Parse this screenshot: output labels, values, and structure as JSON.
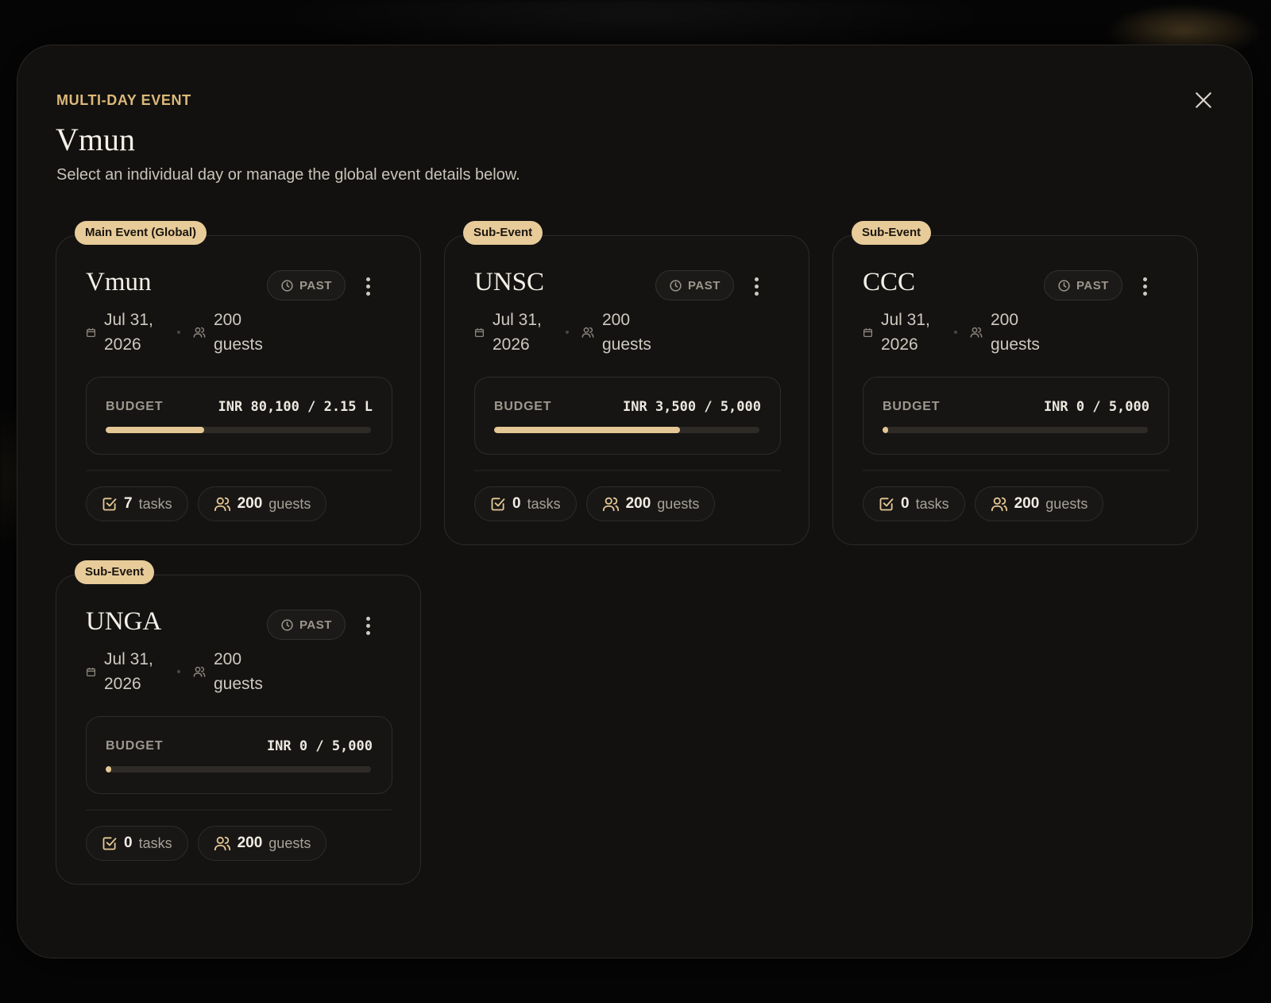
{
  "modal": {
    "eyebrow": "MULTI-DAY EVENT",
    "title": "Vmun",
    "subtitle": "Select an individual day or manage the global event details below."
  },
  "labels": {
    "budget": "BUDGET",
    "tasks_suffix": "tasks",
    "guests_suffix": "guests"
  },
  "colors": {
    "accent": "#dcb978",
    "badge_bg": "#e7cb98",
    "progress_fill": "#e4c794"
  },
  "icons": {
    "close": "close-icon",
    "status": "clock-icon",
    "menu": "more-vertical-icon",
    "date": "calendar-icon",
    "guests": "users-icon",
    "tasks": "checkbox-icon"
  },
  "events": [
    {
      "badge": "Main Event (Global)",
      "name": "Vmun",
      "status": "PAST",
      "date_line1": "Jul 31,",
      "date_line2": "2026",
      "guests_line1": "200",
      "guests_line2": "guests",
      "budget_value": "INR 80,100 / 2.15 L",
      "budget_fraction": 0.37,
      "tasks_count": "7",
      "guests_count": "200"
    },
    {
      "badge": "Sub-Event",
      "name": "UNSC",
      "status": "PAST",
      "date_line1": "Jul 31,",
      "date_line2": "2026",
      "guests_line1": "200",
      "guests_line2": "guests",
      "budget_value": "INR 3,500 / 5,000",
      "budget_fraction": 0.7,
      "tasks_count": "0",
      "guests_count": "200"
    },
    {
      "badge": "Sub-Event",
      "name": "CCC",
      "status": "PAST",
      "date_line1": "Jul 31,",
      "date_line2": "2026",
      "guests_line1": "200",
      "guests_line2": "guests",
      "budget_value": "INR 0 / 5,000",
      "budget_fraction": 0,
      "tasks_count": "0",
      "guests_count": "200"
    },
    {
      "badge": "Sub-Event",
      "name": "UNGA",
      "status": "PAST",
      "date_line1": "Jul 31,",
      "date_line2": "2026",
      "guests_line1": "200",
      "guests_line2": "guests",
      "budget_value": "INR 0 / 5,000",
      "budget_fraction": 0,
      "tasks_count": "0",
      "guests_count": "200"
    }
  ]
}
